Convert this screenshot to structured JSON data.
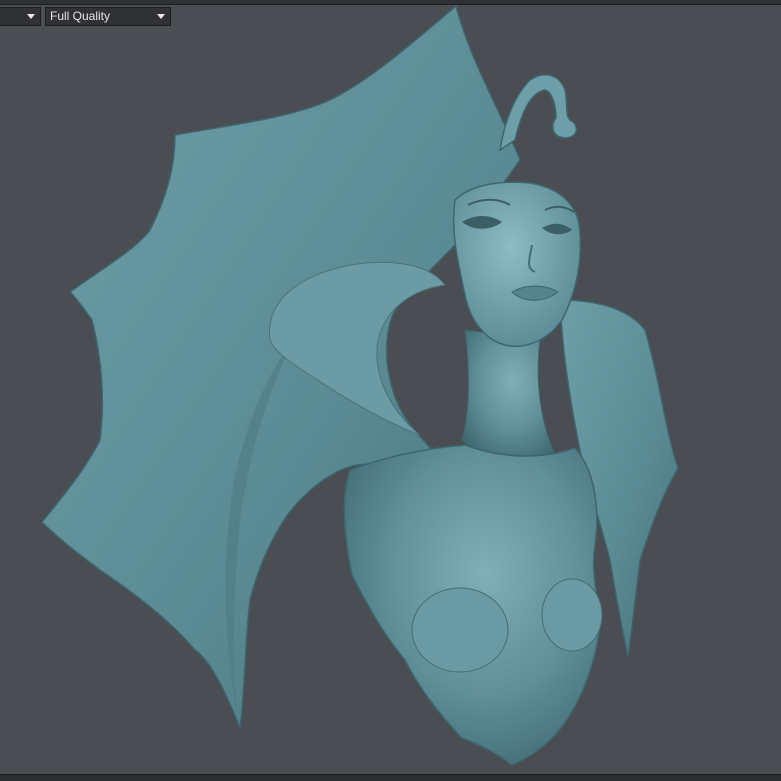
{
  "toolbar": {
    "view_mode_value": "",
    "quality_value": "Full Quality"
  },
  "icons": {
    "dropdown_arrow": "chevron-down-icon"
  },
  "colors": {
    "viewport_background": "#4a4d52",
    "model_base": "#5f8f98",
    "model_shadow": "#3f676f",
    "model_highlight": "#86b6be"
  }
}
